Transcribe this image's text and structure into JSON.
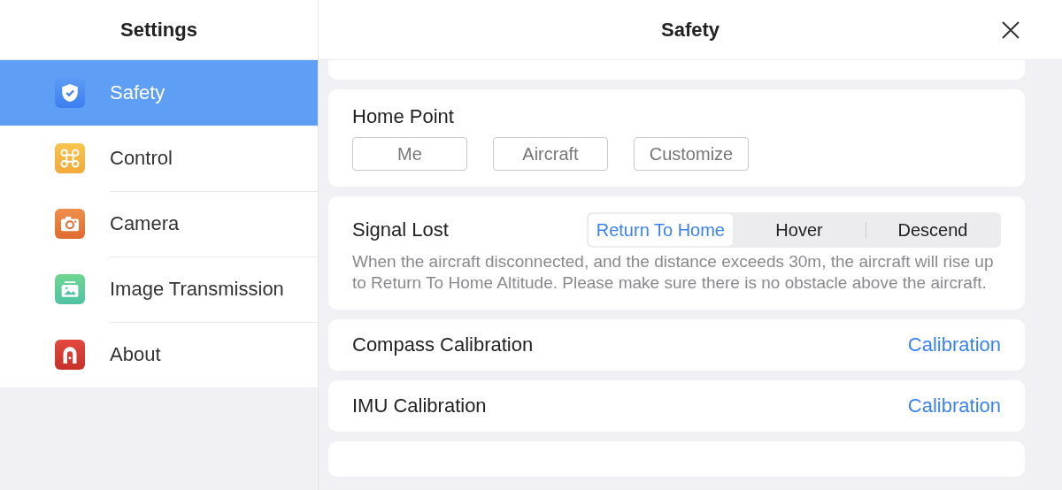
{
  "sidebar": {
    "title": "Settings",
    "items": [
      {
        "label": "Safety",
        "kind": "shield",
        "selected": true
      },
      {
        "label": "Control",
        "kind": "drone",
        "selected": false
      },
      {
        "label": "Camera",
        "kind": "camera",
        "selected": false
      },
      {
        "label": "Image Transmission",
        "kind": "image",
        "selected": false
      },
      {
        "label": "About",
        "kind": "about",
        "selected": false
      }
    ]
  },
  "panel": {
    "title": "Safety",
    "cards": [
      {
        "kind": "top_edge"
      },
      {
        "kind": "choices",
        "title": "Home Point",
        "options": [
          "Me",
          "Aircraft",
          "Customize"
        ]
      },
      {
        "kind": "segmented",
        "title": "Signal Lost",
        "segments": [
          {
            "label": "Return To Home",
            "selected": true
          },
          {
            "label": "Hover",
            "selected": false
          },
          {
            "label": "Descend",
            "selected": false
          }
        ],
        "description": "When the aircraft disconnected, and the distance exceeds 30m, the aircraft will rise up to Return To Home Altitude. Please make sure there is no obstacle above the aircraft."
      },
      {
        "kind": "action",
        "title": "Compass Calibration",
        "action": "Calibration"
      },
      {
        "kind": "action",
        "title": "IMU Calibration",
        "action": "Calibration"
      },
      {
        "kind": "bottom_edge"
      }
    ]
  }
}
